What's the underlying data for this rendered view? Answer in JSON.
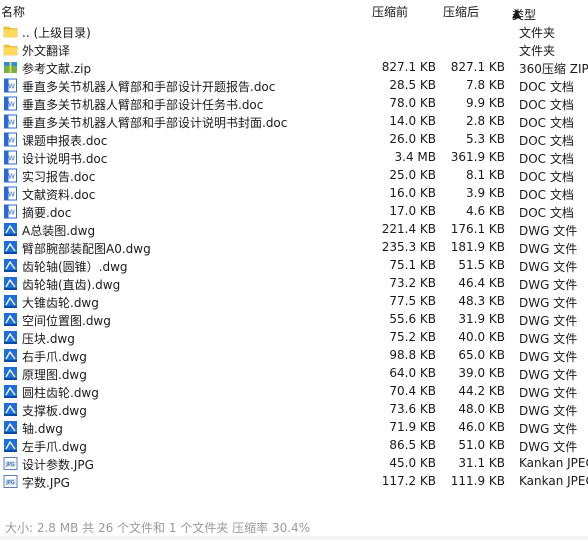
{
  "columns": {
    "name": "名称",
    "size": "压缩前",
    "compressed": "压缩后",
    "type": "类型",
    "sort_arrow": "▲"
  },
  "rows": [
    {
      "name": ".. (上级目录)",
      "size": "",
      "compressed": "",
      "type": "文件夹",
      "icon": "folder-icon"
    },
    {
      "name": "外文翻译",
      "size": "",
      "compressed": "",
      "type": "文件夹",
      "icon": "folder-icon"
    },
    {
      "name": "参考文献.zip",
      "size": "827.1 KB",
      "compressed": "827.1 KB",
      "type": "360压缩 ZIP",
      "icon": "zip-icon"
    },
    {
      "name": "垂直多关节机器人臂部和手部设计开题报告.doc",
      "size": "28.5 KB",
      "compressed": "7.8 KB",
      "type": "DOC 文档",
      "icon": "doc-icon"
    },
    {
      "name": "垂直多关节机器人臂部和手部设计任务书.doc",
      "size": "78.0 KB",
      "compressed": "9.9 KB",
      "type": "DOC 文档",
      "icon": "doc-icon"
    },
    {
      "name": "垂直多关节机器人臂部和手部设计说明书封面.doc",
      "size": "14.0 KB",
      "compressed": "2.8 KB",
      "type": "DOC 文档",
      "icon": "doc-icon"
    },
    {
      "name": "课题申报表.doc",
      "size": "26.0 KB",
      "compressed": "5.3 KB",
      "type": "DOC 文档",
      "icon": "doc-icon"
    },
    {
      "name": "设计说明书.doc",
      "size": "3.4 MB",
      "compressed": "361.9 KB",
      "type": "DOC 文档",
      "icon": "doc-icon"
    },
    {
      "name": "实习报告.doc",
      "size": "25.0 KB",
      "compressed": "8.1 KB",
      "type": "DOC 文档",
      "icon": "doc-icon"
    },
    {
      "name": "文献资料.doc",
      "size": "16.0 KB",
      "compressed": "3.9 KB",
      "type": "DOC 文档",
      "icon": "doc-icon"
    },
    {
      "name": "摘要.doc",
      "size": "17.0 KB",
      "compressed": "4.6 KB",
      "type": "DOC 文档",
      "icon": "doc-icon"
    },
    {
      "name": "A总装图.dwg",
      "size": "221.4 KB",
      "compressed": "176.1 KB",
      "type": "DWG 文件",
      "icon": "dwg-icon"
    },
    {
      "name": "臂部腕部装配图A0.dwg",
      "size": "235.3 KB",
      "compressed": "181.9 KB",
      "type": "DWG 文件",
      "icon": "dwg-icon"
    },
    {
      "name": "齿轮轴(圆锥）.dwg",
      "size": "75.1 KB",
      "compressed": "51.5 KB",
      "type": "DWG 文件",
      "icon": "dwg-icon"
    },
    {
      "name": "齿轮轴(直齿).dwg",
      "size": "73.2 KB",
      "compressed": "46.4 KB",
      "type": "DWG 文件",
      "icon": "dwg-icon"
    },
    {
      "name": "大锥齿轮.dwg",
      "size": "77.5 KB",
      "compressed": "48.3 KB",
      "type": "DWG 文件",
      "icon": "dwg-icon"
    },
    {
      "name": "空间位置图.dwg",
      "size": "55.6 KB",
      "compressed": "31.9 KB",
      "type": "DWG 文件",
      "icon": "dwg-icon"
    },
    {
      "name": "压块.dwg",
      "size": "75.2 KB",
      "compressed": "40.0 KB",
      "type": "DWG 文件",
      "icon": "dwg-icon"
    },
    {
      "name": "右手爪.dwg",
      "size": "98.8 KB",
      "compressed": "65.0 KB",
      "type": "DWG 文件",
      "icon": "dwg-icon"
    },
    {
      "name": "原理图.dwg",
      "size": "64.0 KB",
      "compressed": "39.0 KB",
      "type": "DWG 文件",
      "icon": "dwg-icon"
    },
    {
      "name": "圆柱齿轮.dwg",
      "size": "70.4 KB",
      "compressed": "44.2 KB",
      "type": "DWG 文件",
      "icon": "dwg-icon"
    },
    {
      "name": "支撑板.dwg",
      "size": "73.6 KB",
      "compressed": "48.0 KB",
      "type": "DWG 文件",
      "icon": "dwg-icon"
    },
    {
      "name": "轴.dwg",
      "size": "71.9 KB",
      "compressed": "46.0 KB",
      "type": "DWG 文件",
      "icon": "dwg-icon"
    },
    {
      "name": "左手爪.dwg",
      "size": "86.5 KB",
      "compressed": "51.0 KB",
      "type": "DWG 文件",
      "icon": "dwg-icon"
    },
    {
      "name": "设计参数.JPG",
      "size": "45.0 KB",
      "compressed": "31.1 KB",
      "type": "Kankan JPEG",
      "icon": "jpg-icon"
    },
    {
      "name": "字数.JPG",
      "size": "117.2 KB",
      "compressed": "111.9 KB",
      "type": "Kankan JPEG",
      "icon": "jpg-icon"
    }
  ],
  "status": "大小: 2.8 MB 共 26 个文件和 1 个文件夹 压缩率 30.4%",
  "colors": {
    "folder": "#f5c33b",
    "doc": "#2b6bd1",
    "dwg": "#1f6fd8",
    "zip": "#2f8fd8",
    "status_text": "#9a9a9a"
  }
}
